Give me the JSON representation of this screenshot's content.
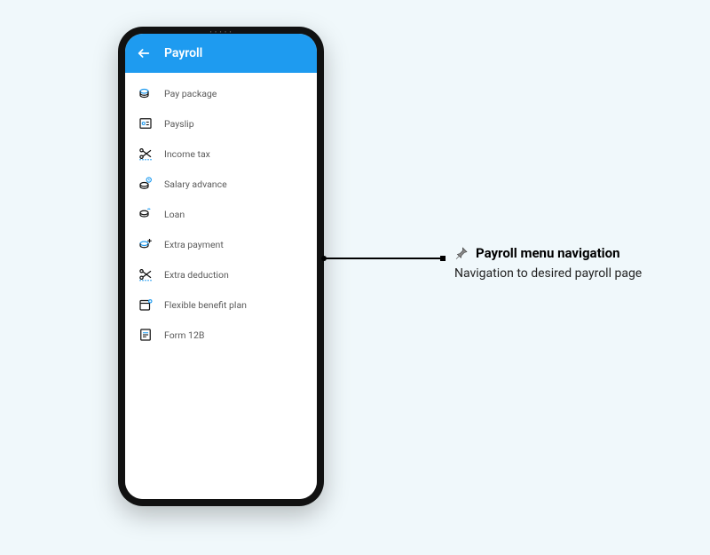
{
  "appbar": {
    "title": "Payroll"
  },
  "menu": {
    "items": [
      {
        "label": "Pay package",
        "icon": "coins-icon"
      },
      {
        "label": "Payslip",
        "icon": "payslip-icon"
      },
      {
        "label": "Income tax",
        "icon": "scissors-icon"
      },
      {
        "label": "Salary advance",
        "icon": "coins-clock-icon"
      },
      {
        "label": "Loan",
        "icon": "coins-hand-icon"
      },
      {
        "label": "Extra payment",
        "icon": "coins-plus-icon"
      },
      {
        "label": "Extra deduction",
        "icon": "scissors-icon"
      },
      {
        "label": "Flexible benefit plan",
        "icon": "box-plus-icon"
      },
      {
        "label": "Form 12B",
        "icon": "form-icon"
      }
    ]
  },
  "callout": {
    "title": "Payroll menu navigation",
    "subtitle": "Navigation to desired payroll page"
  }
}
